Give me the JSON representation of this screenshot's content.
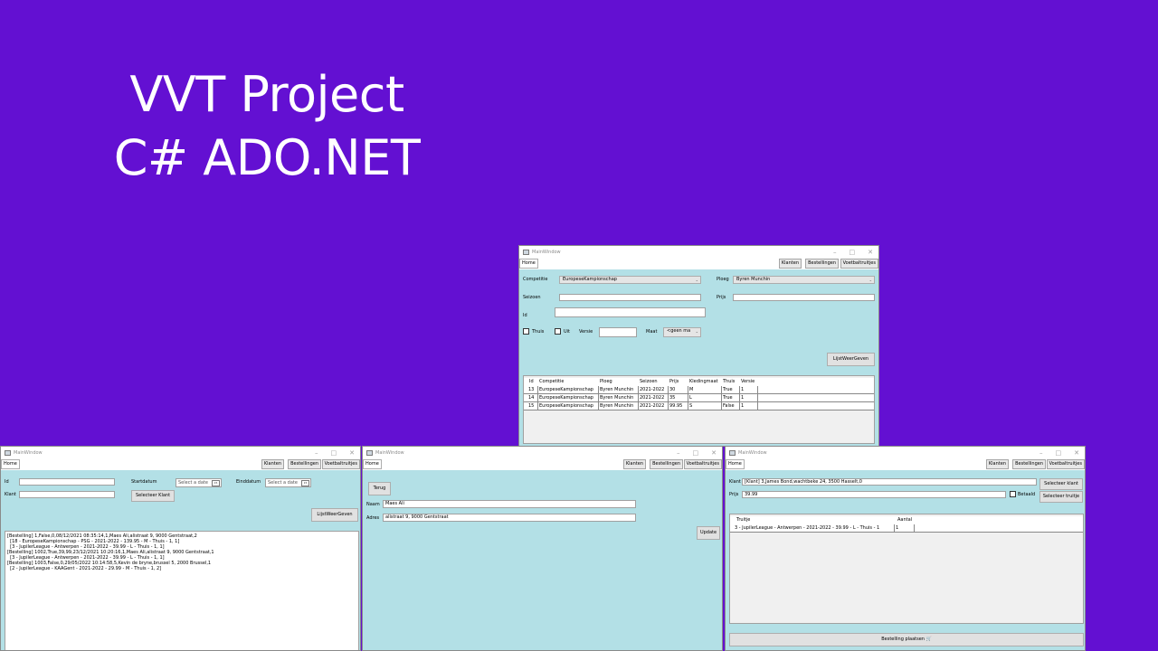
{
  "slide": {
    "title_line1": "VVT Project",
    "title_line2": "C# ADO.NET"
  },
  "window_title": "MainWindow",
  "nav": {
    "home": "Home",
    "klanten": "Klanten",
    "bestellingen": "Bestellingen",
    "voetbaltruitjes": "Voetbaltruitjes"
  },
  "truitjes_form": {
    "competitie_label": "Competitie",
    "competitie_value": "EuropeseKampionschap",
    "ploeg_label": "Ploeg",
    "ploeg_value": "Byren Munchin",
    "seizoen_label": "Seizoen",
    "prijs_label": "Prijs",
    "id_label": "Id",
    "thuis_label": "Thuis",
    "uit_label": "Uit",
    "versie_label": "Versie",
    "maat_label": "Maat",
    "maat_value": "<geen ma",
    "lijst_button": "LijstWeerGeven",
    "columns": [
      "Id",
      "Competitie",
      "Ploeg",
      "Seizoen",
      "Prijs",
      "Kledingmaat",
      "Thuis",
      "Versie"
    ],
    "rows": [
      [
        "13",
        "EuropeseKampionschap",
        "Byren Munchin",
        "2021-2022",
        "30",
        "M",
        "True",
        "1"
      ],
      [
        "14",
        "EuropeseKampionschap",
        "Byren Munchin",
        "2021-2022",
        "35",
        "L",
        "True",
        "1"
      ],
      [
        "15",
        "EuropeseKampionschap",
        "Byren Munchin",
        "2021-2022",
        "99.95",
        "S",
        "False",
        "1"
      ]
    ]
  },
  "bestellingen_form": {
    "id_label": "Id",
    "klant_label": "Klant",
    "startdatum_label": "Startdatum",
    "einddatum_label": "Einddatum",
    "date_placeholder": "Select a date",
    "selecteer_klant_button": "Selecteer Klant",
    "lijst_button": "LijstWeerGeven",
    "list_lines": [
      "[Bestelling] 1,False,0,08/12/2021 08:35:14,1,Maes Ali,alistraat 9, 9000 Gentstraat,2",
      "  [18 - EuropeseKampionschap - PSG - 2021-2022 - 139.95 - M - Thuis - 1, 1]",
      "  [3 - JupilerLeague - Antwerpen - 2021-2022 - 39.99 - L - Thuis - 1, 1]",
      "[Bestelling] 1002,True,39,99,23/12/2021 10:20:16,1,Maes Ali,alistraat 9, 9000 Gentstraat,1",
      "  [3 - JupilerLeague - Antwerpen - 2021-2022 - 39.99 - L - Thuis - 1, 1]",
      "[Bestelling] 1003,False,0,29/05/2022 10:14:58,5,Kevin de bryne,brussel 5, 2000 Brussel,1",
      "  [2 - JupilerLeague - KAAGent - 2021-2022 - 29.99 - M - Thuis - 1, 2]"
    ]
  },
  "klant_form": {
    "terug_button": "Terug",
    "naam_label": "Naam",
    "naam_value": "Maes Ali",
    "adres_label": "Adres",
    "adres_value": "alistraat 9, 9000 Gentstraat",
    "update_button": "Update"
  },
  "bestelling_plaatsen_form": {
    "klant_label": "Klant",
    "klant_value": "[Klant] 3,James Bond,wachtbeke 24, 3500 Hasselt,0",
    "prijs_label": "Prijs",
    "prijs_value": "39.99",
    "betaald_label": "Betaald",
    "selecteer_klant_button": "Selecteer klant",
    "selecteer_truitje_button": "Selecteer truitje",
    "columns": [
      "Truitje",
      "Aantal"
    ],
    "rows": [
      [
        "3 - JupilerLeague - Antwerpen - 2021-2022 - 39.99 - L - Thuis - 1",
        "1"
      ]
    ],
    "plaatsen_button": "Bestelling plaatsen"
  }
}
